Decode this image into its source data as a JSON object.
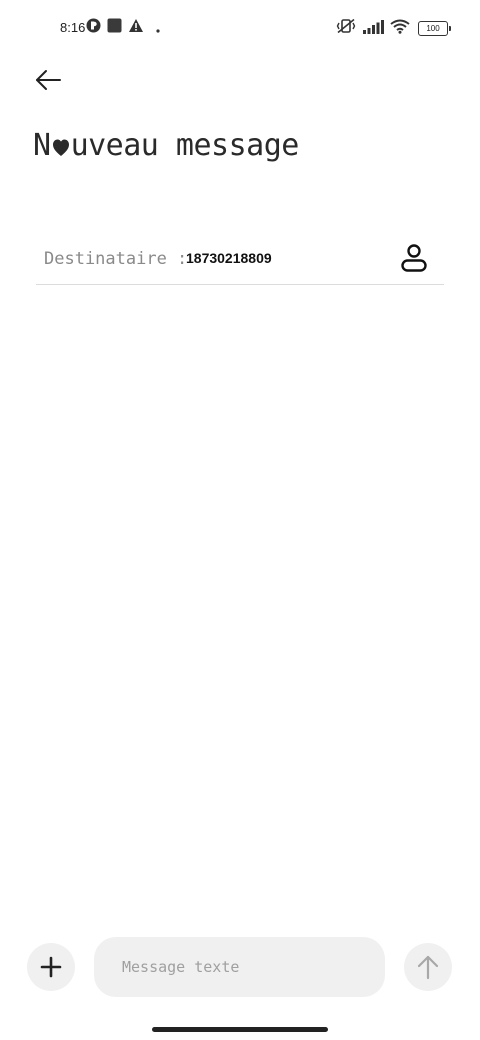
{
  "status_bar": {
    "time": "8:16",
    "battery_level": "100",
    "left_icons": [
      "notification-badge-icon",
      "square-notification-icon",
      "warning-icon",
      "dot-icon"
    ],
    "right_icons": [
      "vibrate-off-icon",
      "signal-icon",
      "wifi-icon",
      "battery-icon"
    ]
  },
  "header": {
    "back_icon": "arrow-left-icon",
    "title_prefix": "N",
    "title_suffix": "uveau message",
    "title_heart_icon": "heart-icon"
  },
  "recipient": {
    "label": "Destinataire :",
    "value": "18730218809",
    "contact_icon": "person-icon"
  },
  "composer": {
    "add_icon": "plus-icon",
    "placeholder": "Message texte",
    "value": "",
    "send_icon": "arrow-up-icon"
  },
  "colors": {
    "background": "#ffffff",
    "pill_background": "#f0f0f0",
    "divider": "#dcdcdc",
    "label_gray": "#8a8a8a",
    "text_dark": "#222222"
  }
}
